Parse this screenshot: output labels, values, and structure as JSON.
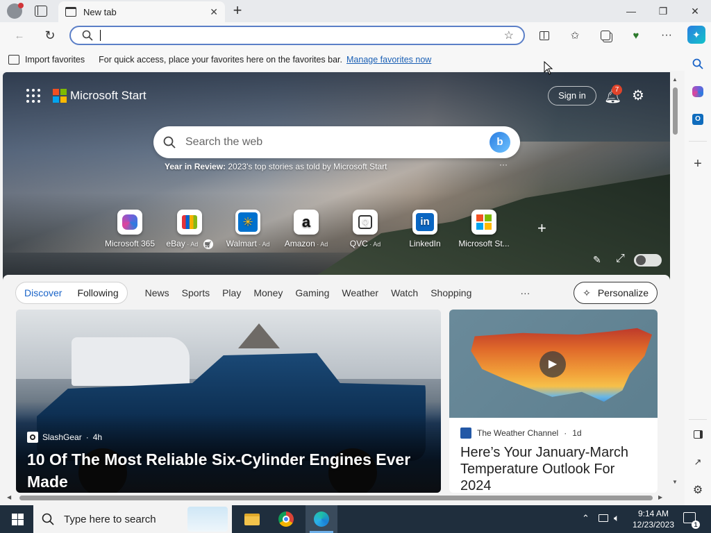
{
  "browser": {
    "tab_title": "New tab",
    "address_value": "",
    "favbar": {
      "import_label": "Import favorites",
      "hint": "For quick access, place your favorites here on the favorites bar.",
      "manage_link": "Manage favorites now"
    }
  },
  "page": {
    "brand": "Microsoft Start",
    "sign_in": "Sign in",
    "notification_count": "7",
    "search_placeholder": "Search the web",
    "year_in_review_bold": "Year in Review:",
    "year_in_review_text": " 2023's top stories as told by Microsoft Start",
    "quick_links": [
      {
        "label": "Microsoft 365",
        "ad": ""
      },
      {
        "label": "eBay",
        "ad": " · Ad"
      },
      {
        "label": "Walmart",
        "ad": " · Ad"
      },
      {
        "label": "Amazon",
        "ad": " · Ad"
      },
      {
        "label": "QVC",
        "ad": " · Ad"
      },
      {
        "label": "LinkedIn",
        "ad": ""
      },
      {
        "label": "Microsoft St...",
        "ad": ""
      }
    ],
    "nav_tabs": {
      "discover": "Discover",
      "following": "Following",
      "items": [
        "News",
        "Sports",
        "Play",
        "Money",
        "Gaming",
        "Weather",
        "Watch",
        "Shopping"
      ],
      "more": "···",
      "personalize": "Personalize"
    },
    "main_card": {
      "source": "SlashGear",
      "age": "4h",
      "headline": "10 Of The Most Reliable Six-Cylinder Engines Ever Made"
    },
    "side_card": {
      "source": "The Weather Channel",
      "age": "1d",
      "headline": "Here’s Your January-March Temperature Outlook For 2024"
    }
  },
  "taskbar": {
    "search_placeholder": "Type here to search",
    "time": "9:14 AM",
    "date": "12/23/2023"
  },
  "colors": {
    "accent": "#1a64c8",
    "taskbar": "#1f2e3d",
    "badge": "#e0442b"
  }
}
